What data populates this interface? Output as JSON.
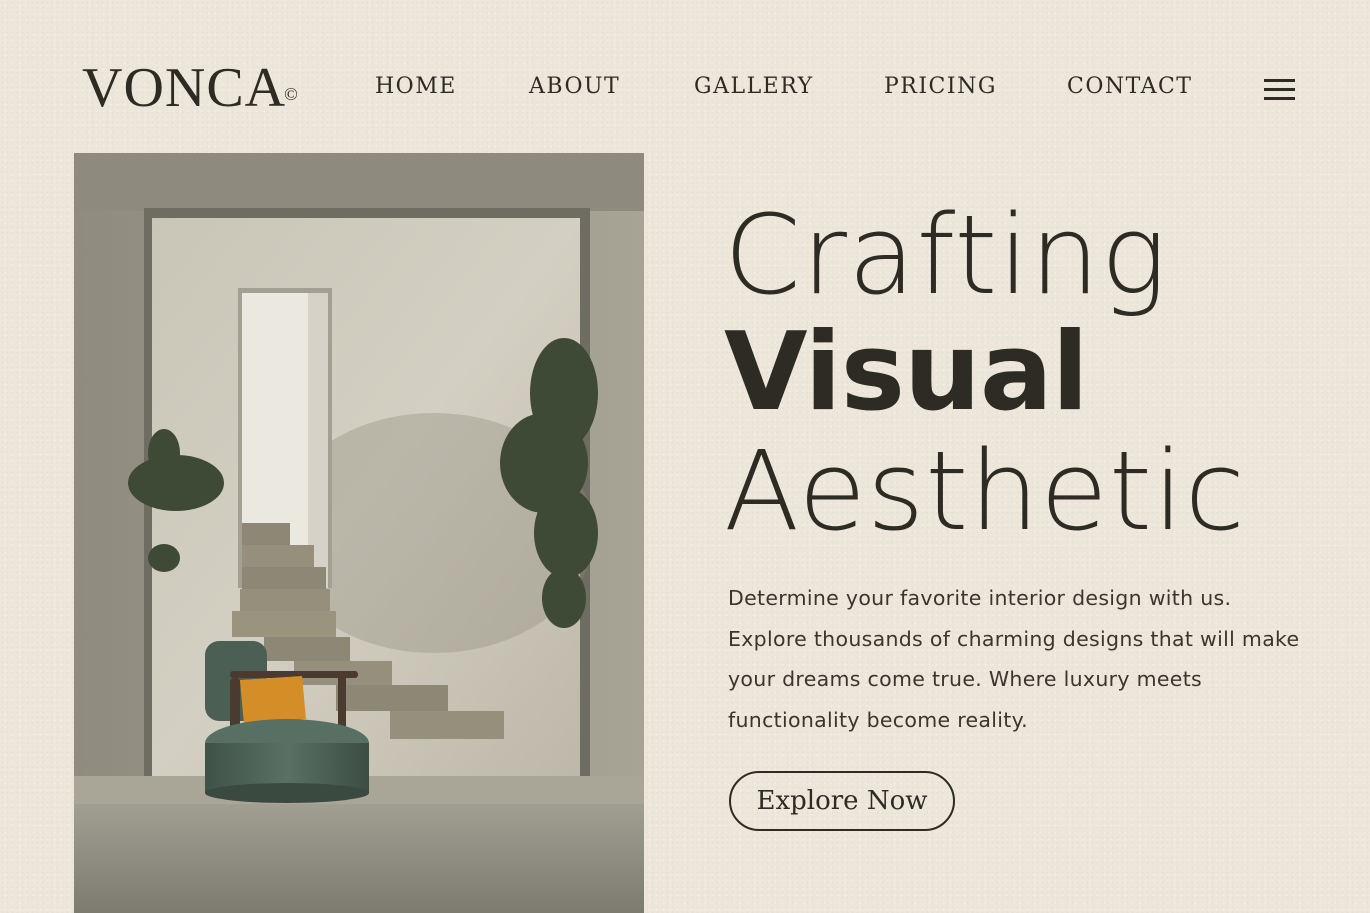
{
  "brand": {
    "name": "VONCA",
    "mark": "©"
  },
  "nav": {
    "items": [
      {
        "label": "HOME"
      },
      {
        "label": "ABOUT"
      },
      {
        "label": "GALLERY"
      },
      {
        "label": "PRICING"
      },
      {
        "label": "CONTACT"
      }
    ],
    "menu_icon": "hamburger-menu-icon"
  },
  "hero": {
    "line1": "Crafting",
    "line2": "Visual",
    "line3": "Aesthetic",
    "description": [
      "Determine your favorite interior design with us.",
      "Explore thousands of charming designs that will make",
      "your dreams come true. Where luxury meets",
      "functionality become reality."
    ],
    "cta_label": "Explore Now"
  },
  "colors": {
    "background": "#ece7da",
    "text": "#2e2b24",
    "chair": "#4f6458",
    "cushion": "#d9952a"
  }
}
